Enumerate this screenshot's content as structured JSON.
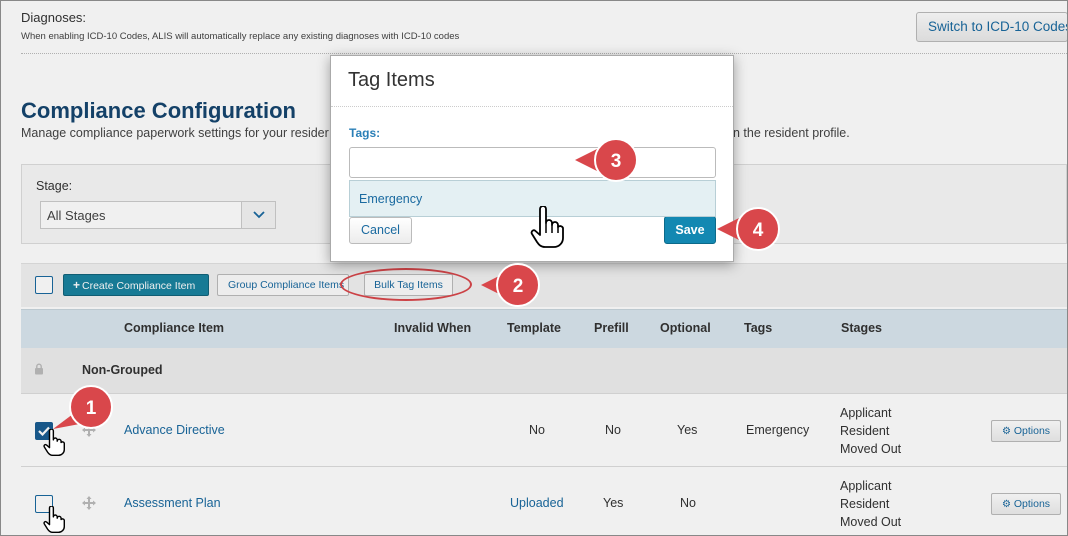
{
  "diagnoses": {
    "label": "Diagnoses:",
    "note": "When enabling ICD-10 Codes, ALIS will automatically replace any existing diagnoses with ICD-10 codes",
    "switch_button": "Switch to ICD-10 Codes"
  },
  "section": {
    "title": "Compliance Configuration",
    "description_left": "Manage compliance paperwork settings for your resider",
    "description_right": "n the resident profile."
  },
  "stage_filter": {
    "label": "Stage:",
    "selected": "All Stages"
  },
  "toolbar": {
    "create_label": "Create Compliance Item",
    "group_label": "Group Compliance Items",
    "bulk_tag_label": "Bulk Tag Items"
  },
  "table": {
    "columns": [
      "Compliance Item",
      "Invalid When",
      "Template",
      "Prefill",
      "Optional",
      "Tags",
      "Stages"
    ],
    "group_title": "Non-Grouped",
    "rows": [
      {
        "name": "Advance Directive",
        "checked": true,
        "invalid_when": "",
        "template": "No",
        "prefill": "No",
        "optional": "Yes",
        "tags": "Emergency",
        "stages": [
          "Applicant",
          "Resident",
          "Moved Out"
        ],
        "options_label": "Options"
      },
      {
        "name": "Assessment Plan",
        "checked": false,
        "invalid_when": "",
        "template": "Uploaded",
        "prefill": "Yes",
        "optional": "No",
        "tags": "",
        "stages": [
          "Applicant",
          "Resident",
          "Moved Out"
        ],
        "options_label": "Options"
      }
    ]
  },
  "modal": {
    "title": "Tag Items",
    "tags_label": "Tags:",
    "tags_value": "",
    "suggestion": "Emergency",
    "cancel_label": "Cancel",
    "save_label": "Save"
  },
  "callouts": [
    "1",
    "2",
    "3",
    "4"
  ],
  "icons": {
    "plus": "plus-icon",
    "lock": "lock-icon",
    "drag": "drag-handle-icon",
    "gear": "gear-icon",
    "chevron": "chevron-down-icon",
    "check": "checkmark-icon",
    "cursor": "hand-pointer-icon"
  },
  "colors": {
    "accent": "#1a6aa0",
    "primary_button": "#19829f",
    "title": "#16466f",
    "callout": "#d9474b"
  }
}
